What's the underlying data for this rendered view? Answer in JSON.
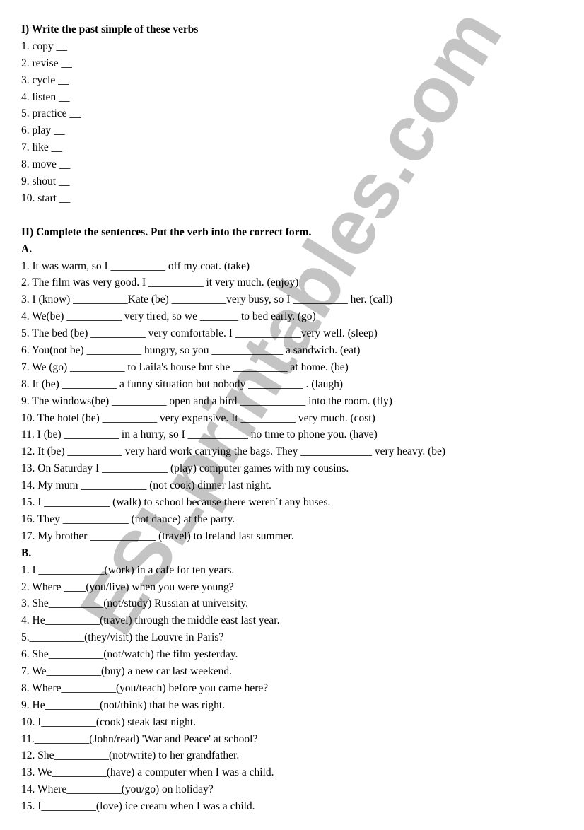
{
  "watermark": {
    "text": "ESLprintables.com",
    "color": "#c4c4c4"
  },
  "section1": {
    "title": "I) Write the past simple of these verbs",
    "items": [
      "1. copy __",
      "2. revise __",
      "3. cycle __",
      "4. listen __",
      "5. practice __",
      "6. play __",
      "7. like __",
      "8. move __",
      "9. shout __",
      "10. start __"
    ]
  },
  "section2": {
    "title": "II) Complete the sentences. Put the verb into the correct form.",
    "partA": {
      "label": "A.",
      "items": [
        "1. It was warm, so I __________ off my coat. (take)",
        "2. The film was very good. I __________ it very much. (enjoy)",
        "3. I (know) __________Kate (be) __________very busy, so I __________ her. (call)",
        "4. We(be) __________ very tired, so we _______ to bed early. (go)",
        "5. The bed (be) __________ very comfortable. I ____________very well. (sleep)",
        "6. You(not be) __________ hungry, so you _____________ a sandwich. (eat)",
        "7. We (go) __________ to Laila's house but she __________ at home. (be)",
        "8. It (be) __________ a funny situation but nobody __________ . (laugh)",
        "9. The windows(be) __________ open and a bird ____________ into the room. (fly)",
        "10. The hotel (be) __________ very expensive. It __________ very much. (cost)",
        "11. I (be) __________ in a hurry, so I ___________ no time to phone you. (have)",
        "12. It (be) __________ very hard work carrying the bags. They _____________ very heavy. (be)",
        "13. On Saturday I ____________ (play) computer games with my cousins.",
        "14. My mum ____________ (not cook) dinner last night.",
        "15. I ____________ (walk) to school because there weren´t any buses.",
        "16. They ____________ (not dance) at the party.",
        "17. My brother ____________ (travel) to Ireland last summer."
      ]
    },
    "partB": {
      "label": "B.",
      "items": [
        "1. I ____________(work) in a cafe for ten years.",
        "2. Where ____(you/live) when you were young?",
        "3. She__________(not/study) Russian at university.",
        "4. He__________(travel) through the middle east last year.",
        "5.__________(they/visit) the Louvre in Paris?",
        "6. She__________(not/watch) the film yesterday.",
        "7. We__________(buy) a new car last weekend.",
        "8. Where__________(you/teach) before you came here?",
        "9. He__________(not/think) that he was right.",
        "10. I__________(cook) steak last night.",
        "11.__________(John/read) 'War and Peace' at school?",
        "12. She__________(not/write) to her grandfather.",
        "13. We__________(have) a computer when I was a child.",
        "14. Where__________(you/go) on holiday?",
        "15. I__________(love) ice cream when I was a child."
      ]
    }
  }
}
